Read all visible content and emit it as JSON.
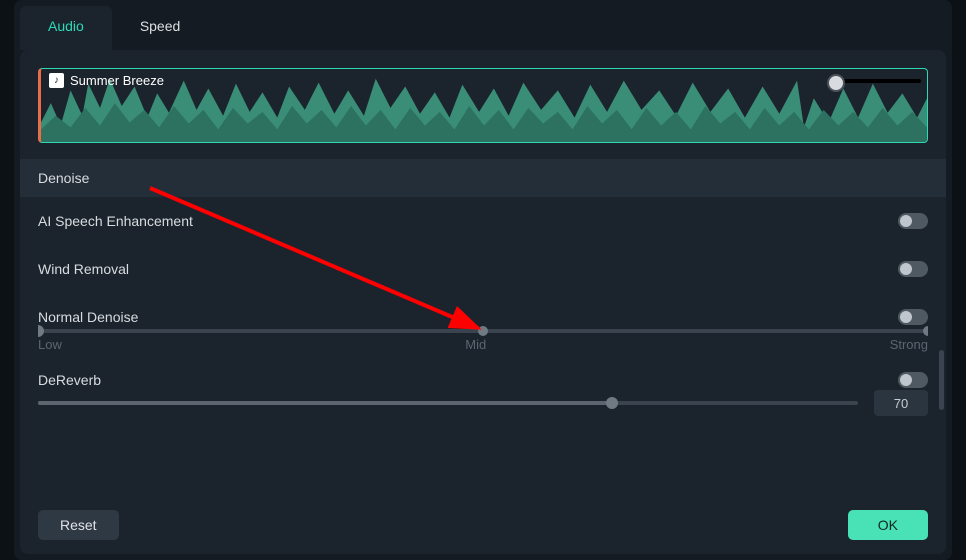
{
  "tabs": {
    "audio": "Audio",
    "speed": "Speed"
  },
  "clip": {
    "name": "Summer Breeze"
  },
  "section": {
    "denoise": "Denoise"
  },
  "options": {
    "ai_speech": "AI Speech Enhancement",
    "wind_removal": "Wind Removal",
    "normal_denoise": "Normal Denoise",
    "dereverb": "DeReverb"
  },
  "slider": {
    "normal": {
      "low": "Low",
      "mid": "Mid",
      "strong": "Strong",
      "value_pct": 0
    },
    "dereverb": {
      "value": "70",
      "value_pct": 70
    }
  },
  "buttons": {
    "reset": "Reset",
    "ok": "OK"
  },
  "colors": {
    "accent": "#2fd9b5",
    "ok_bg": "#49e2b7"
  }
}
